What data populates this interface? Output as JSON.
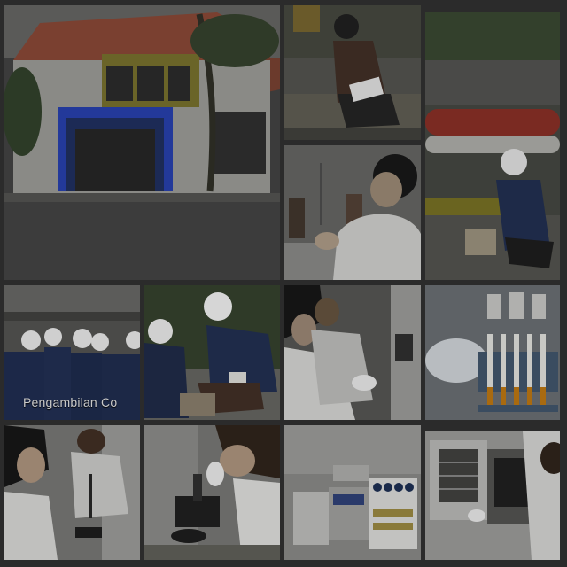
{
  "caption": {
    "text": "Pengambilan Co"
  },
  "tiles": [
    {
      "subject": "building-exterior"
    },
    {
      "subject": "field-sampling-worker"
    },
    {
      "subject": "pipeline-sampling-worker"
    },
    {
      "subject": "lab-analyst-bottles"
    },
    {
      "subject": "team-in-helmets"
    },
    {
      "subject": "field-testing-kit"
    },
    {
      "subject": "lab-analysts-at-instrument"
    },
    {
      "subject": "test-tubes-rack"
    },
    {
      "subject": "lab-analyst-pipetting"
    },
    {
      "subject": "microscope-analyst"
    },
    {
      "subject": "reagent-kit"
    },
    {
      "subject": "lab-oven-incubator"
    }
  ],
  "colors": {
    "background": "#2b2b2b",
    "tint": "#3a3a3a"
  }
}
